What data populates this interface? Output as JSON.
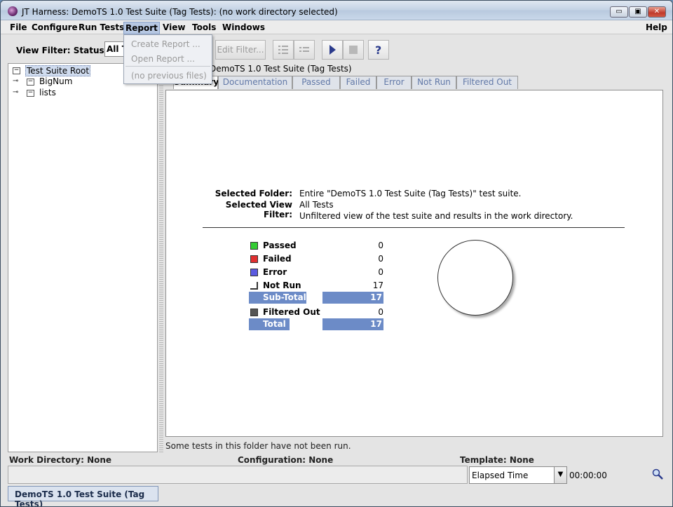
{
  "window": {
    "title": "JT Harness: DemoTS 1.0 Test Suite (Tag Tests): (no work directory selected)",
    "minimize_label": "▭",
    "maximize_label": "▣",
    "close_label": "✕"
  },
  "menubar": {
    "file": "File",
    "configure": "Configure",
    "run_tests": "Run Tests",
    "report": "Report",
    "view": "View",
    "tools": "Tools",
    "windows": "Windows",
    "help": "Help"
  },
  "report_menu": {
    "create": "Create Report ...",
    "open": "Open Report ...",
    "previous": "(no previous files)"
  },
  "toolbar": {
    "view_filter_label": "View Filter: Status of",
    "view_filter_value": "All Tests",
    "edit_filter": "Edit Filter..."
  },
  "tree": {
    "root": "Test Suite Root",
    "children": [
      "BigNum",
      "lists"
    ]
  },
  "panel": {
    "title": "DemoTS 1.0 Test Suite (Tag Tests)",
    "tabs": [
      "Summary",
      "Documentation",
      "Passed",
      "Failed",
      "Error",
      "Not Run",
      "Filtered Out"
    ]
  },
  "summary": {
    "selected_folder_label": "Selected Folder:",
    "selected_folder_value": "Entire \"DemoTS 1.0 Test Suite (Tag Tests)\" test suite.",
    "selected_view_filter_label": "Selected View Filter:",
    "selected_view_filter_value": "All Tests",
    "filter_description": "Unfiltered view of the test suite and results in the work directory.",
    "stats": {
      "passed": {
        "label": "Passed",
        "value": "0",
        "color": "#33cc33"
      },
      "failed": {
        "label": "Failed",
        "value": "0",
        "color": "#e03030"
      },
      "error": {
        "label": "Error",
        "value": "0",
        "color": "#5a5ae0"
      },
      "not_run": {
        "label": "Not Run",
        "value": "17"
      },
      "sub_total": {
        "label": "Sub-Total",
        "value": "17"
      },
      "filtered_out": {
        "label": "Filtered Out",
        "value": "0",
        "color": "#555555"
      },
      "total": {
        "label": "Total",
        "value": "17"
      }
    }
  },
  "status_message": "Some tests in this folder have not been run.",
  "info": {
    "work_directory_label": "Work Directory:",
    "work_directory_value": "None",
    "configuration_label": "Configuration:",
    "configuration_value": "None",
    "template_label": "Template:",
    "template_value": "None"
  },
  "timer": {
    "mode": "Elapsed Time",
    "value": "00:00:00"
  },
  "bottom_tab": "DemoTS 1.0 Test Suite (Tag Tests)",
  "colors": {
    "bar_blue": "#6c8bc7",
    "tab_text": "#6279a8"
  }
}
